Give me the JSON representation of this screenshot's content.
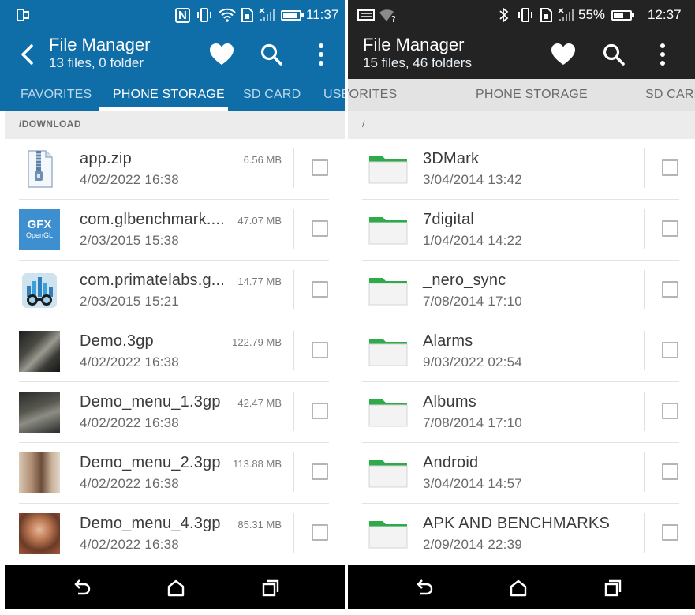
{
  "left": {
    "status": {
      "time": "11:37",
      "nfc": "N"
    },
    "app_bar": {
      "title": "File Manager",
      "subtitle": "13 files, 0 folder"
    },
    "tabs": [
      {
        "label": "FAVORITES",
        "active": false
      },
      {
        "label": "PHONE STORAGE",
        "active": true
      },
      {
        "label": "SD CARD",
        "active": false
      },
      {
        "label": "USB",
        "active": false
      }
    ],
    "path": "/DOWNLOAD",
    "files": [
      {
        "name": "app.zip",
        "date": "4/02/2022 16:38",
        "size": "6.56 MB",
        "thumb": "zip-icon"
      },
      {
        "name": "com.glbenchmark....",
        "date": "2/03/2015 15:38",
        "size": "47.07 MB",
        "thumb": "gfx-icon",
        "thumb_text": "GFX",
        "thumb_sub": "OpenGL"
      },
      {
        "name": "com.primatelabs.g...",
        "date": "2/03/2015 15:21",
        "size": "14.77 MB",
        "thumb": "geekbench-icon"
      },
      {
        "name": "Demo.3gp",
        "date": "4/02/2022 16:38",
        "size": "122.79 MB",
        "thumb": "video-thumbnail"
      },
      {
        "name": "Demo_menu_1.3gp",
        "date": "4/02/2022 16:38",
        "size": "42.47 MB",
        "thumb": "video-thumbnail"
      },
      {
        "name": "Demo_menu_2.3gp",
        "date": "4/02/2022 16:38",
        "size": "113.88 MB",
        "thumb": "video-thumbnail"
      },
      {
        "name": "Demo_menu_4.3gp",
        "date": "4/02/2022 16:38",
        "size": "85.31 MB",
        "thumb": "video-thumbnail"
      }
    ]
  },
  "right": {
    "status": {
      "time": "12:37",
      "battery": "55%"
    },
    "app_bar": {
      "title": "File Manager",
      "subtitle": "15 files, 46 folders"
    },
    "tabs": [
      {
        "label": "FAVORITES",
        "active": false
      },
      {
        "label": "PHONE STORAGE",
        "active": true
      },
      {
        "label": "SD CARD",
        "active": false
      }
    ],
    "path": "/",
    "folders": [
      {
        "name": "3DMark",
        "date": "3/04/2014 13:42"
      },
      {
        "name": "7digital",
        "date": "1/04/2014 14:22"
      },
      {
        "name": "_nero_sync",
        "date": "7/08/2014 17:10"
      },
      {
        "name": "Alarms",
        "date": "9/03/2022 02:54"
      },
      {
        "name": "Albums",
        "date": "7/08/2014 17:10"
      },
      {
        "name": "Android",
        "date": "3/04/2014 14:57"
      },
      {
        "name": "APK AND BENCHMARKS",
        "date": "2/09/2014 22:39"
      }
    ]
  },
  "colors": {
    "left_bar": "#0f6ea8",
    "right_bar": "#232323",
    "folder_green": "#2eaa4a"
  },
  "icons": {
    "back": "back-arrow-icon",
    "favorite": "heart-icon",
    "search": "search-icon",
    "overflow": "more-vert-icon",
    "nav_back": "nav-back-icon",
    "nav_home": "nav-home-icon",
    "nav_recents": "nav-recents-icon"
  }
}
